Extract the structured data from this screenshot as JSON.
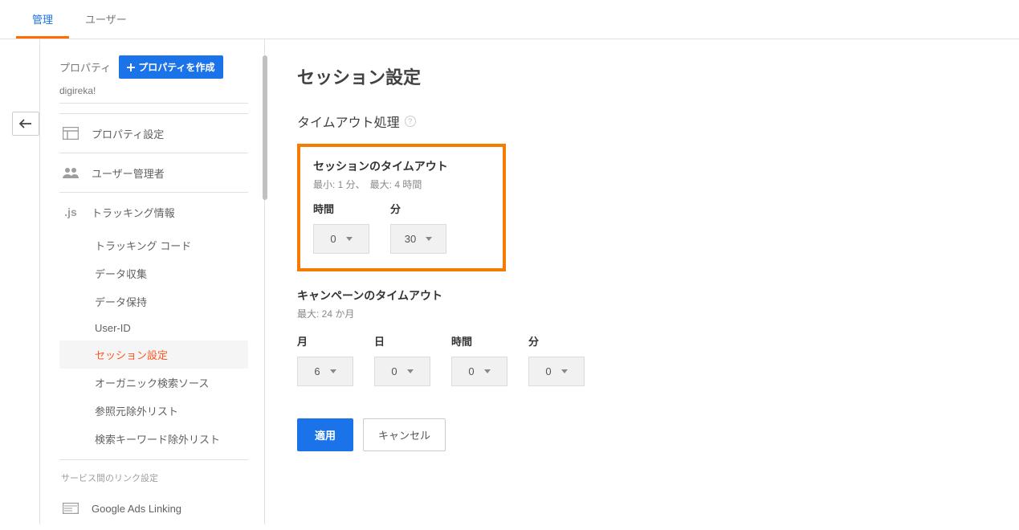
{
  "tabs": {
    "admin": "管理",
    "user": "ユーザー"
  },
  "sidebar": {
    "property_label": "プロパティ",
    "create_property": "プロパティを作成",
    "property_name": "digireka!",
    "nav": {
      "property_settings": "プロパティ設定",
      "user_management": "ユーザー管理者",
      "tracking_info": "トラッキング情報"
    },
    "tracking_sub": [
      "トラッキング コード",
      "データ収集",
      "データ保持",
      "User-ID",
      "セッション設定",
      "オーガニック検索ソース",
      "参照元除外リスト",
      "検索キーワード除外リスト"
    ],
    "service_link_title": "サービス間のリンク設定",
    "google_ads_linking": "Google Ads Linking"
  },
  "main": {
    "title": "セッション設定",
    "timeout_heading": "タイムアウト処理",
    "session_timeout": {
      "heading": "セッションのタイムアウト",
      "limits": "最小: 1 分、　最大: 4 時間",
      "hours_label": "時間",
      "minutes_label": "分",
      "hours_value": "0",
      "minutes_value": "30"
    },
    "campaign_timeout": {
      "heading": "キャンペーンのタイムアウト",
      "limits": "最大: 24 か月",
      "months_label": "月",
      "days_label": "日",
      "hours_label": "時間",
      "minutes_label": "分",
      "months_value": "6",
      "days_value": "0",
      "hours_value": "0",
      "minutes_value": "0"
    },
    "apply_button": "適用",
    "cancel_button": "キャンセル"
  }
}
